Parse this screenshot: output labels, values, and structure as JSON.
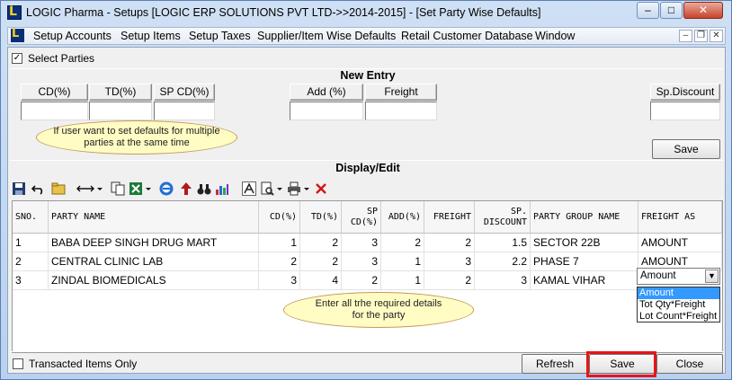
{
  "window": {
    "title": "LOGIC Pharma - Setups  [LOGIC ERP SOLUTIONS PVT LTD->>2014-2015] - [Set Party Wise Defaults]",
    "minimize": "–",
    "maximize": "□",
    "close": "✕"
  },
  "menu": {
    "items": [
      "Setup Accounts",
      "Setup Items",
      "Setup Taxes",
      "Supplier/Item Wise Defaults",
      "Retail Customer Database",
      "Window"
    ],
    "mdi_min": "–",
    "mdi_restore": "❐",
    "mdi_close": "✕"
  },
  "select_parties": {
    "label": "Select Parties",
    "checked": "✓"
  },
  "new_entry": {
    "title": "New Entry",
    "headers": [
      "CD(%)",
      "TD(%)",
      "SP CD(%)",
      "Add (%)",
      "Freight",
      "Sp.Discount"
    ],
    "save": "Save"
  },
  "callouts": {
    "multi_party": "If user want to set defaults for multiple parties at the same time",
    "enter_details": "Enter all trhe required details for the party"
  },
  "display_edit": {
    "title": "Display/Edit"
  },
  "toolbar_icons": [
    "save-icon",
    "undo-icon",
    "folder-icon",
    "resize-columns-icon",
    "dropdown-icon",
    "copy-icon",
    "excel-icon",
    "dropdown-icon",
    "ie-icon",
    "upload-icon",
    "binoculars-icon",
    "chart-icon",
    "font-icon",
    "print-preview-icon",
    "dropdown-icon",
    "printer-icon",
    "dropdown-icon",
    "delete-icon"
  ],
  "grid": {
    "headers": [
      "SNO.",
      "PARTY NAME",
      "CD(%)",
      "TD(%)",
      "SP\nCD(%)",
      "ADD(%)",
      "FREIGHT",
      "SP.\nDISCOUNT",
      "PARTY GROUP NAME",
      "FREIGHT AS"
    ],
    "rows": [
      [
        "1",
        "BABA DEEP SINGH DRUG MART",
        "1",
        "2",
        "3",
        "2",
        "2",
        "1.5",
        "SECTOR 22B",
        "AMOUNT"
      ],
      [
        "2",
        "CENTRAL CLINIC LAB",
        "2",
        "2",
        "3",
        "1",
        "3",
        "2.2",
        "PHASE 7",
        "AMOUNT"
      ],
      [
        "3",
        "ZINDAL BIOMEDICALS",
        "3",
        "4",
        "2",
        "1",
        "2",
        "3",
        "KAMAL VIHAR",
        ""
      ]
    ],
    "freight_as_select": {
      "value": "Amount",
      "options": [
        "Amount",
        "Tot Qty*Freight",
        "Lot Count*Freight"
      ]
    }
  },
  "footer": {
    "transacted_only": "Transacted Items Only",
    "refresh": "Refresh",
    "save": "Save",
    "close": "Close"
  },
  "colors": {
    "highlight": "#e8141b",
    "balloon_fill": "#fffcc4",
    "selection": "#3399ff"
  }
}
